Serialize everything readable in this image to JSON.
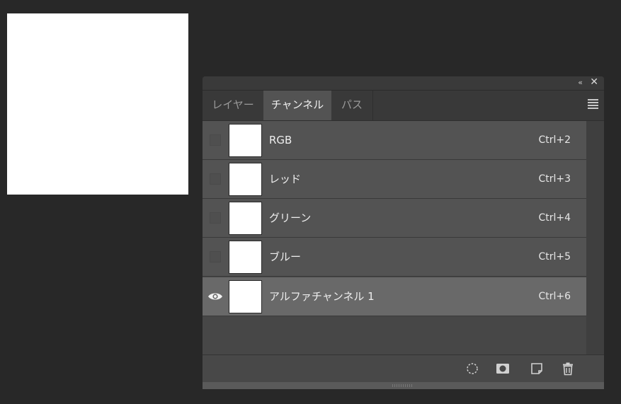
{
  "panel": {
    "collapse_icon": "«",
    "close_icon": "✕",
    "tabs": [
      {
        "label": "レイヤー"
      },
      {
        "label": "チャンネル"
      },
      {
        "label": "パス"
      }
    ],
    "active_tab": "チャンネル"
  },
  "channels": [
    {
      "name": "RGB",
      "shortcut": "Ctrl+2",
      "visible": false
    },
    {
      "name": "レッド",
      "shortcut": "Ctrl+3",
      "visible": false
    },
    {
      "name": "グリーン",
      "shortcut": "Ctrl+4",
      "visible": false
    },
    {
      "name": "ブルー",
      "shortcut": "Ctrl+5",
      "visible": false
    },
    {
      "name": "アルファチャンネル 1",
      "shortcut": "Ctrl+6",
      "visible": true
    }
  ],
  "colors": {
    "background": "#282828",
    "panel": "#434343",
    "row": "#535353",
    "row_selected": "#696969"
  }
}
